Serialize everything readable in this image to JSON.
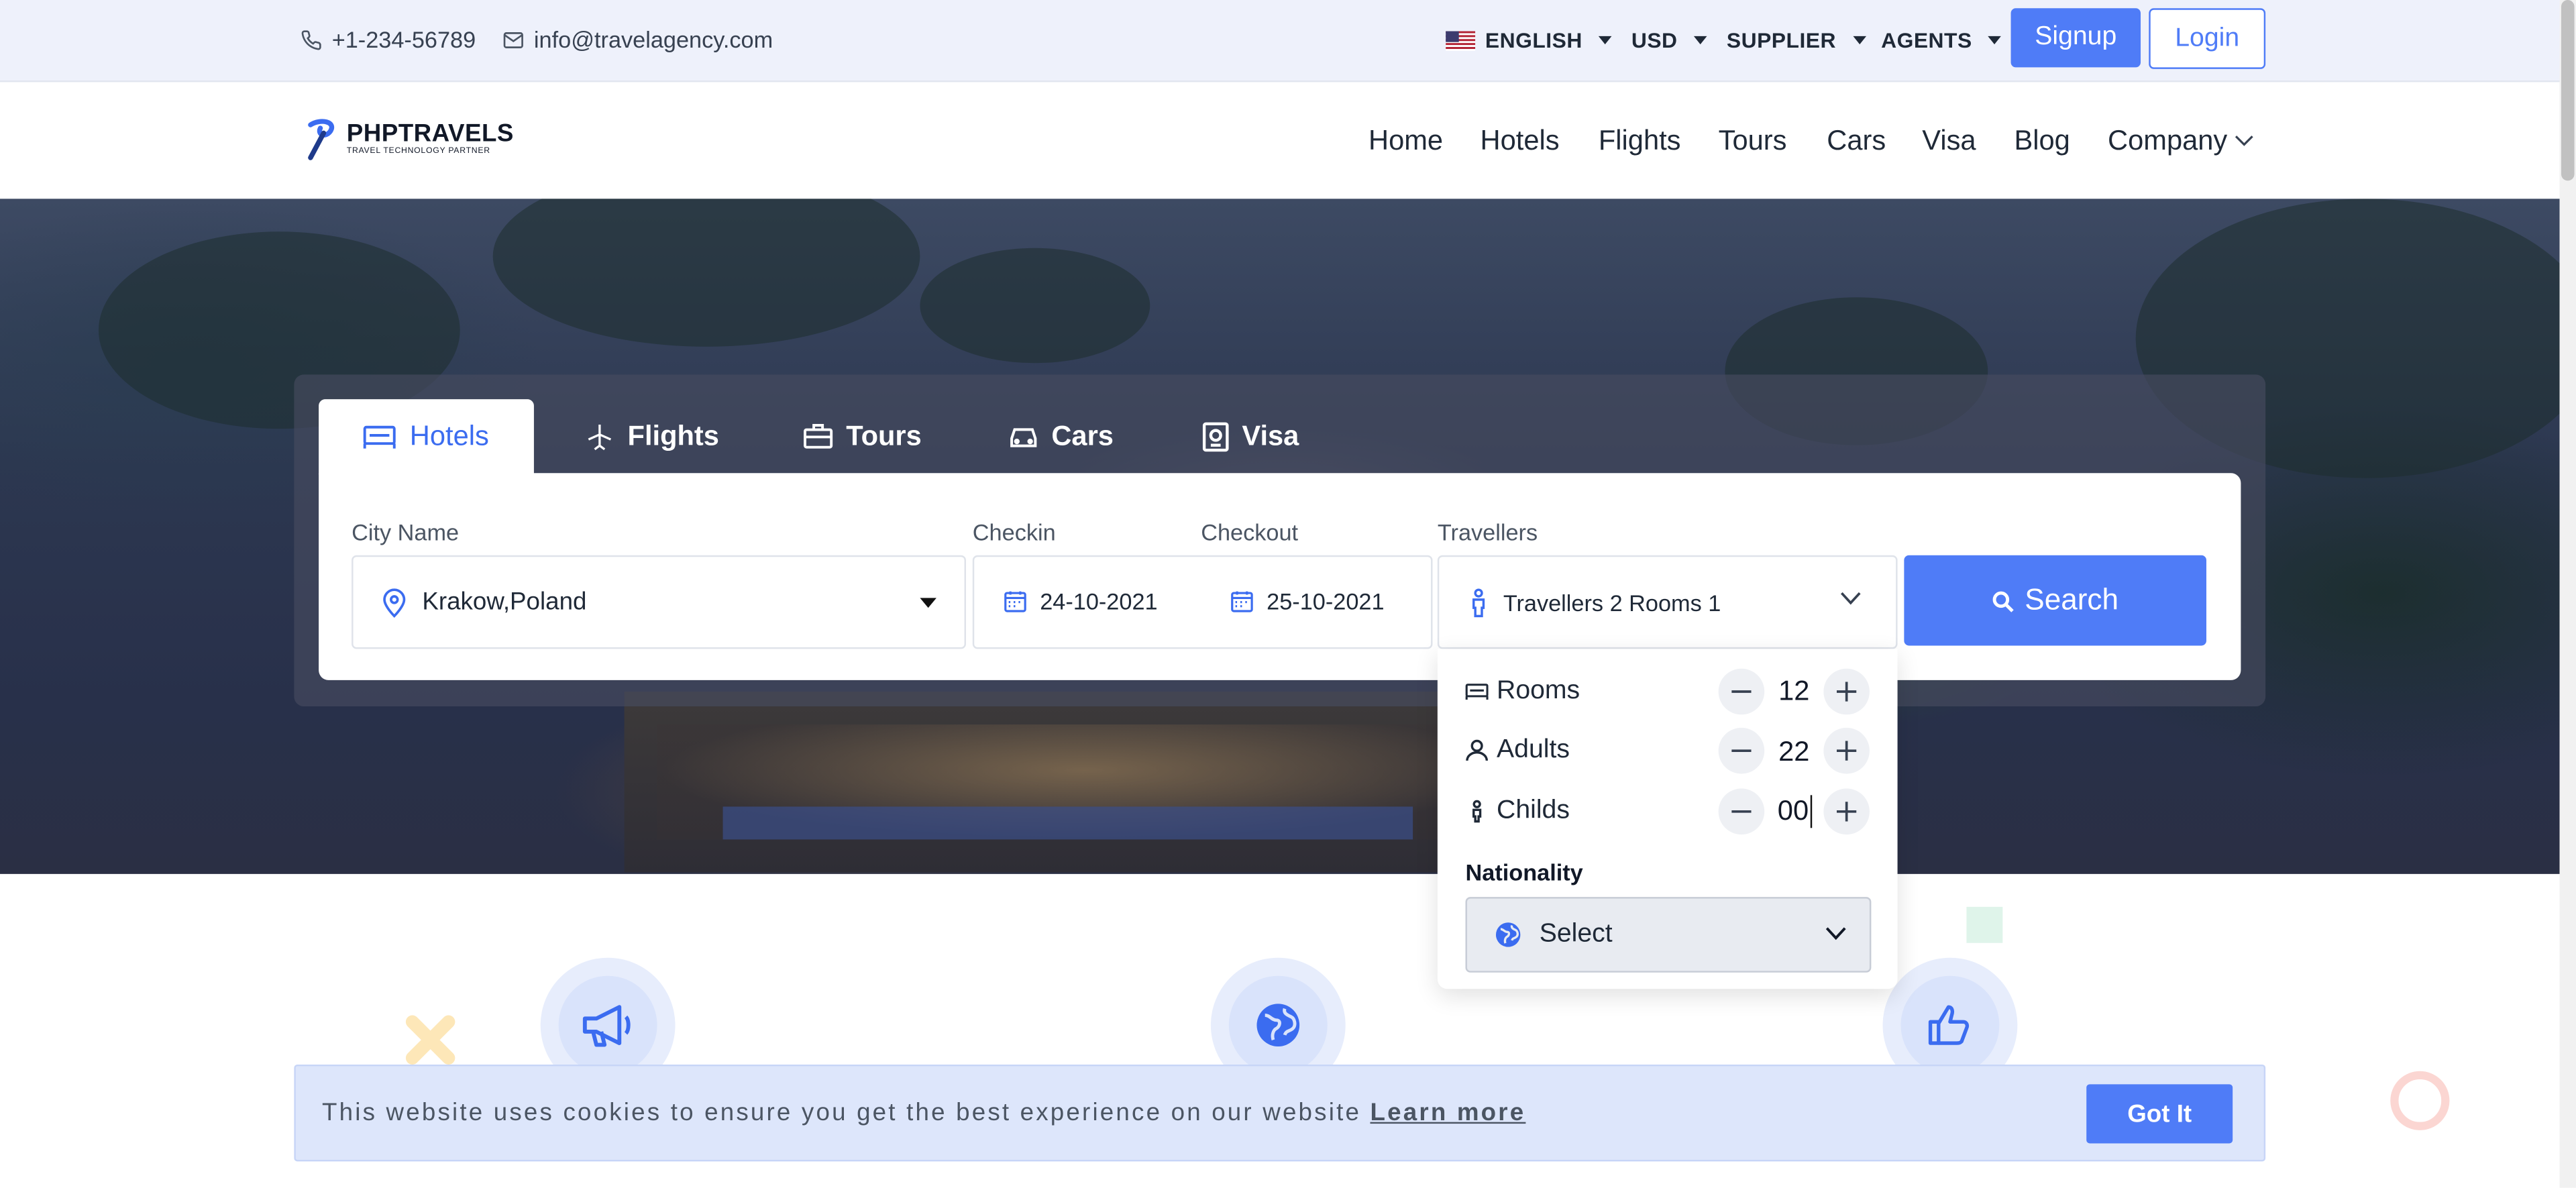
{
  "topbar": {
    "phone": "+1-234-56789",
    "email": "info@travelagency.com",
    "language": "ENGLISH",
    "currency": "USD",
    "supplier": "SUPPLIER",
    "agents": "AGENTS",
    "signup": "Signup",
    "login": "Login"
  },
  "brand": {
    "name": "PHPTRAVELS",
    "tagline": "TRAVEL TECHNOLOGY PARTNER"
  },
  "nav": {
    "home": "Home",
    "hotels": "Hotels",
    "flights": "Flights",
    "tours": "Tours",
    "cars": "Cars",
    "visa": "Visa",
    "blog": "Blog",
    "company": "Company"
  },
  "tabs": {
    "hotels": "Hotels",
    "flights": "Flights",
    "tours": "Tours",
    "cars": "Cars",
    "visa": "Visa"
  },
  "form": {
    "city_label": "City Name",
    "city_value": "Krakow,Poland",
    "checkin_label": "Checkin",
    "checkin_value": "24-10-2021",
    "checkout_label": "Checkout",
    "checkout_value": "25-10-2021",
    "travellers_label": "Travellers",
    "travellers_value": "Travellers 2 Rooms 1",
    "search_label": "Search"
  },
  "travellers_dropdown": {
    "rooms_label": "Rooms",
    "rooms_value": "12",
    "adults_label": "Adults",
    "adults_value": "22",
    "childs_label": "Childs",
    "childs_value": "00",
    "nationality_label": "Nationality",
    "nationality_value": "Select"
  },
  "cookie": {
    "message": "This website uses cookies to ensure you get the best experience on our website",
    "learn_more": "Learn more",
    "got_it": "Got It"
  },
  "colors": {
    "accent": "#4f7cf7",
    "topbar_bg": "#eef1fb",
    "cookie_bg": "#dde6fb"
  }
}
